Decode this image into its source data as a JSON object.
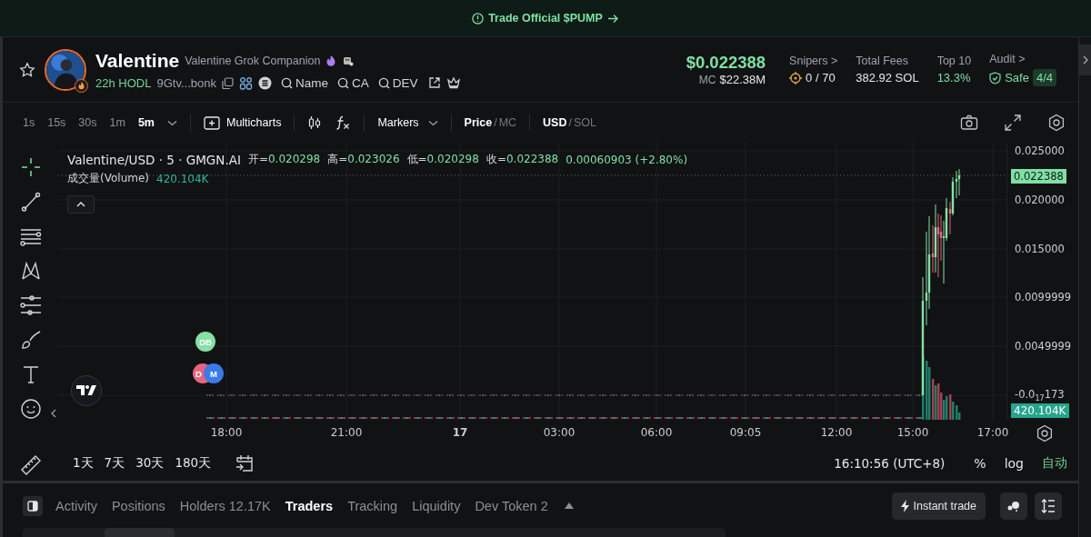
{
  "banner": {
    "text": "Trade Official $PUMP"
  },
  "token": {
    "name": "Valentine",
    "full_name": "Valentine Grok Companion",
    "age": "22h HODL",
    "address": "9Gtv...bonk",
    "links": [
      "Name",
      "CA",
      "DEV"
    ],
    "favorite": false
  },
  "price": {
    "value": "$0.022388",
    "mc_label": "MC",
    "mc": "$22.38M"
  },
  "stats": [
    {
      "label": "Snipers >",
      "value": "0 / 70",
      "kind": "snipers"
    },
    {
      "label": "Total Fees",
      "value": "382.92 SOL",
      "kind": "plain"
    },
    {
      "label": "Top 10",
      "value": "13.3%",
      "kind": "good"
    },
    {
      "label": "Audit >",
      "value": "Safe",
      "badge": "4/4",
      "kind": "audit"
    }
  ],
  "intervals": [
    {
      "label": "1s",
      "selected": false
    },
    {
      "label": "15s",
      "selected": false
    },
    {
      "label": "30s",
      "selected": false
    },
    {
      "label": "1m",
      "selected": false
    },
    {
      "label": "5m",
      "selected": true
    }
  ],
  "toolbar": {
    "multicharts": "Multicharts",
    "markers": "Markers",
    "separator": "/",
    "price_mode": [
      {
        "label": "Price",
        "selected": true
      },
      {
        "label": "MC",
        "selected": false
      }
    ],
    "currency": [
      {
        "label": "USD",
        "selected": true
      },
      {
        "label": "SOL",
        "selected": false
      }
    ]
  },
  "chart": {
    "symbol": "Valentine/USD · 5 · GMGN.AI",
    "ohlc": [
      {
        "label": "开=",
        "value": "0.020298"
      },
      {
        "label": "高=",
        "value": "0.023026"
      },
      {
        "label": "低=",
        "value": "0.020298"
      },
      {
        "label": "收=",
        "value": "0.022388"
      }
    ],
    "change": "0.00060903 (+2.80%)",
    "volume_label": "成交量(Volume)",
    "volume_value": "420.104K",
    "price_ticks": [
      "0.025000",
      "0.020000",
      "0.015000",
      "0.0099999",
      "0.0049999",
      "-0.0$_{17}$173"
    ],
    "last_price": "0.022388",
    "last_volume": "420.104K",
    "time_ticks": [
      "18:00",
      "21:00",
      "17",
      "03:00",
      "06:00",
      "09:05",
      "12:00",
      "15:00",
      "17:00"
    ],
    "markers": [
      {
        "text": "DB",
        "color": "#86e0a6"
      },
      {
        "text": "D",
        "color": "#e8647c"
      },
      {
        "text": "M",
        "color": "#3b7be8"
      }
    ]
  },
  "ranges": [
    "1天",
    "7天",
    "30天",
    "180天"
  ],
  "clock": "16:10:56 (UTC+8)",
  "scale_options": [
    {
      "label": "%",
      "selected": false
    },
    {
      "label": "log",
      "selected": false
    },
    {
      "label": "自动",
      "selected": true
    }
  ],
  "bottom_tabs": [
    {
      "label": "Activity",
      "selected": false
    },
    {
      "label": "Positions",
      "selected": false
    },
    {
      "label": "Holders 12.17K",
      "selected": false
    },
    {
      "label": "Traders",
      "selected": true
    },
    {
      "label": "Tracking",
      "selected": false
    },
    {
      "label": "Liquidity",
      "selected": false
    },
    {
      "label": "Dev Token 2",
      "selected": false
    }
  ],
  "instant_trade": "Instant trade"
}
